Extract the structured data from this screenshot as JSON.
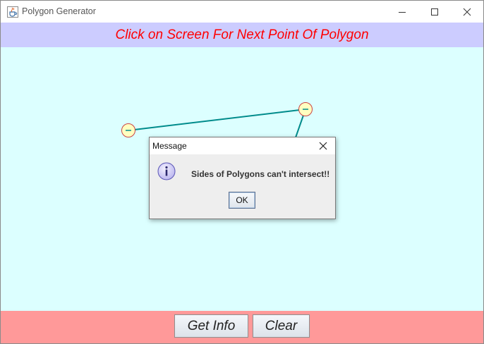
{
  "window": {
    "title": "Polygon Generator",
    "icon": "java-cup-icon",
    "controls": [
      "minimize",
      "maximize",
      "close"
    ]
  },
  "banner": {
    "text": "Click on Screen For Next Point Of Polygon",
    "text_color": "#ff0000",
    "background": "#ccccff"
  },
  "canvas": {
    "background": "#dcffff",
    "line_color": "#008b8b",
    "vertex_fill": "#ffffc0",
    "vertex_stroke": "#cc4444"
  },
  "dialog": {
    "title": "Message",
    "icon": "info-icon",
    "message": "Sides of Polygons can't intersect!!",
    "ok_label": "OK"
  },
  "bottom": {
    "background": "#ff9999",
    "get_info_label": "Get Info",
    "clear_label": "Clear"
  }
}
